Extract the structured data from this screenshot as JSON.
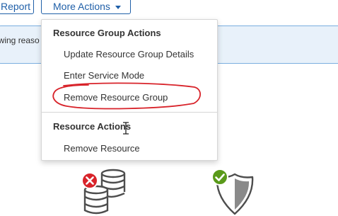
{
  "toolbar": {
    "report_label": "Report",
    "more_actions_label": "More Actions"
  },
  "banner": {
    "text": "owing reaso"
  },
  "menu": {
    "group_header": "Resource Group Actions",
    "group_items": [
      {
        "label": "Update Resource Group Details"
      },
      {
        "label": "Enter Service Mode"
      },
      {
        "label": "Remove Resource Group"
      }
    ],
    "resource_header": "Resource Actions",
    "resource_items": [
      {
        "label": "Remove Resource"
      }
    ]
  },
  "status_icons": [
    {
      "icon": "database-error-icon",
      "status": "error",
      "color": "#d8232a"
    },
    {
      "icon": "shield-check-icon",
      "status": "ok",
      "color": "#5a9a1a"
    }
  ],
  "colors": {
    "accent": "#1f5fa8",
    "annotation": "#d8232a"
  }
}
